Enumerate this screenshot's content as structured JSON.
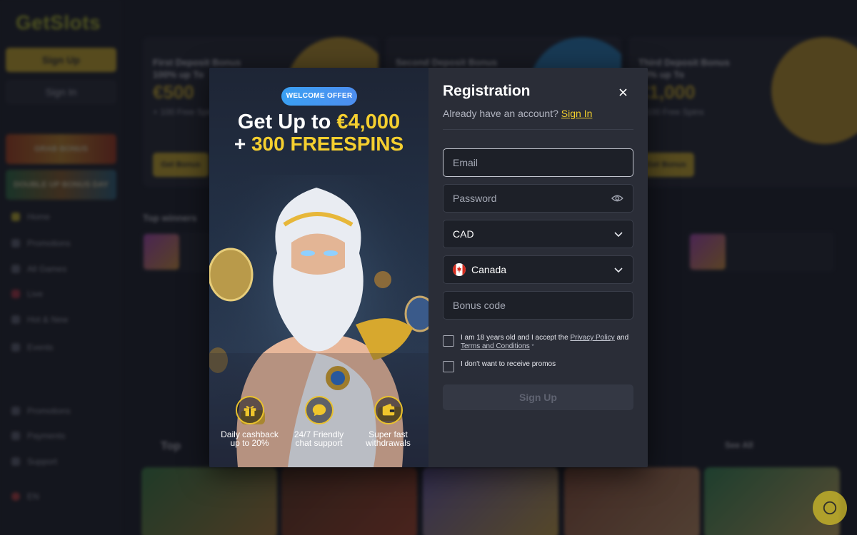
{
  "background": {
    "logo": "GetSlots",
    "signup_label": "Sign Up",
    "signin_label": "Sign In",
    "banners": [
      "GRAB BONUS",
      "DOUBLE UP BONUS DAY"
    ],
    "nav": [
      "Home",
      "Promotions",
      "All Games",
      "Live",
      "Hot & New",
      "Events",
      "Promotions",
      "Payments",
      "Support",
      "EN"
    ],
    "promos": [
      {
        "title": "First Deposit Bonus 100% up To",
        "amount": "€500",
        "freespins": "+ 100 Free Spins",
        "button": "Get Bonus"
      },
      {
        "title": "Second Deposit Bonus",
        "amount": "",
        "freespins": "",
        "button": "Get Bonus"
      },
      {
        "title": "Third Deposit Bonus 50% up To",
        "amount": "€1,000",
        "freespins": "+ 100 Free Spins",
        "button": "Get Bonus"
      }
    ],
    "section_top_winners": "Top winners",
    "section_top": "Top",
    "see_all": "See All"
  },
  "modal": {
    "badge": "WELCOME OFFER",
    "headline_prefix": "Get Up to ",
    "headline_amount": "€4,000",
    "headline2_prefix": "+ ",
    "headline2_amount": "300 FREESPINS",
    "features": [
      {
        "icon": "gift-icon",
        "line1": "Daily cashback",
        "line2": "up to 20%"
      },
      {
        "icon": "chat-bubble-icon",
        "line1": "24/7 Friendly",
        "line2": "chat support"
      },
      {
        "icon": "wallet-icon",
        "line1": "Super fast",
        "line2": "withdrawals"
      }
    ],
    "title": "Registration",
    "have_account": "Already have an account?",
    "sign_in_link": "Sign In",
    "email_placeholder": "Email",
    "password_placeholder": "Password",
    "currency_value": "CAD",
    "country_value": "Canada",
    "bonus_placeholder": "Bonus code",
    "terms_pre": "I am 18 years old and I accept the ",
    "privacy_link": "Privacy Policy",
    "terms_mid": " and",
    "terms_link": "Terms and Conditions",
    "terms_required": "*",
    "no_promos": "I don't want to receive promos",
    "signup_button": "Sign Up",
    "accent_color": "#f5cf2f",
    "badge_color": "#3aa0f2"
  }
}
